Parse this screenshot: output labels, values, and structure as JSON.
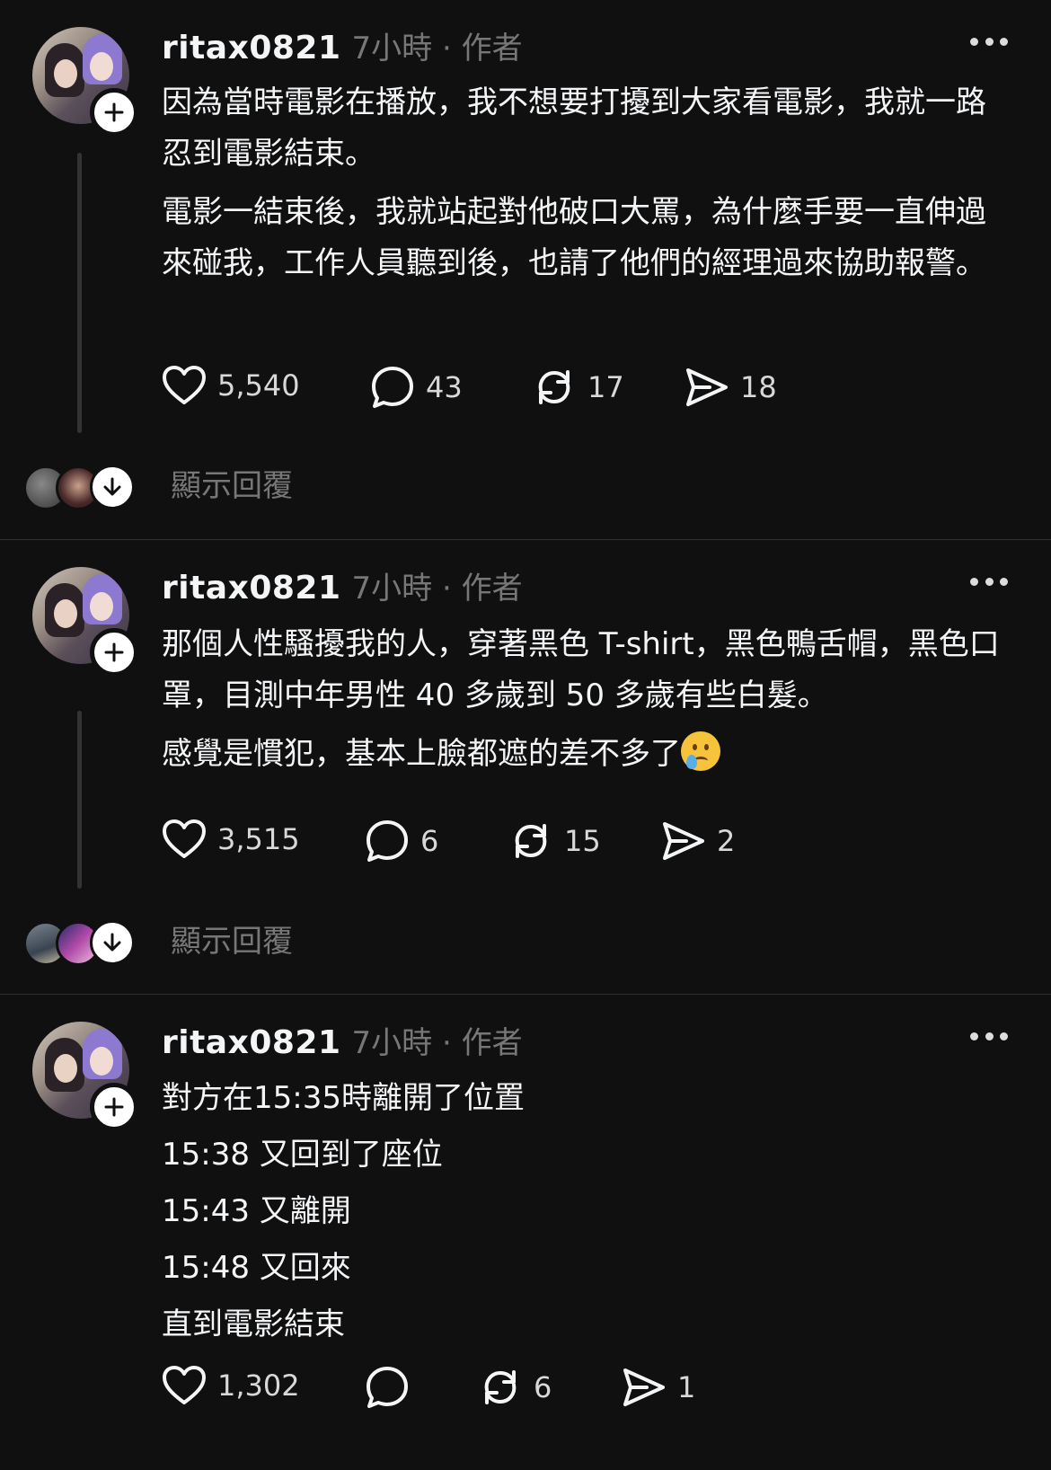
{
  "posts": [
    {
      "username": "ritax0821",
      "meta": "7小時 · 作者",
      "paragraphs": [
        "因為當時電影在播放，我不想要打擾到大家看電影，我就一路忍到電影結束。",
        "電影一結束後，我就站起對他破口大罵，為什麼手要一直伸過來碰我，工作人員聽到後，也請了他們的經理過來協助報警。"
      ],
      "likes": "5,540",
      "comments": "43",
      "reposts": "17",
      "shares": "18",
      "show_replies": "顯示回覆"
    },
    {
      "username": "ritax0821",
      "meta": "7小時 · 作者",
      "paragraphs": [
        "那個人性騷擾我的人，穿著黑色 T-shirt，黑色鴨舌帽，黑色口罩，目測中年男性 40 多歲到 50 多歲有些白髮。",
        "感覺是慣犯，基本上臉都遮的差不多了"
      ],
      "likes": "3,515",
      "comments": "6",
      "reposts": "15",
      "shares": "2",
      "show_replies": "顯示回覆"
    },
    {
      "username": "ritax0821",
      "meta": "7小時 · 作者",
      "paragraphs": [
        "對方在15:35時離開了位置",
        "15:38 又回到了座位",
        "15:43 又離開",
        "15:48 又回來",
        "直到電影結束"
      ],
      "likes": "1,302",
      "comments": "",
      "reposts": "6",
      "shares": "1"
    }
  ],
  "icons": {
    "like": "heart-icon",
    "comment": "comment-bubble-icon",
    "repost": "repost-icon",
    "share": "send-icon",
    "more": "more-dots-icon",
    "follow": "plus-icon",
    "expand": "arrow-down-icon"
  }
}
